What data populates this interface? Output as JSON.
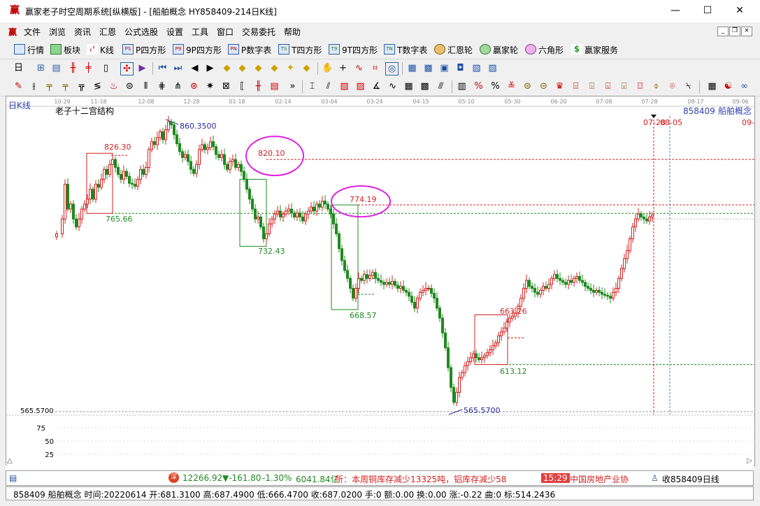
{
  "window": {
    "logo": "赢",
    "title": "赢家老子时空周期系统[纵横版] - [船舶概念  HY858409-214日K线]",
    "minimize": "—",
    "maximize": "☐",
    "close": "✕"
  },
  "menu": {
    "items": [
      "文件",
      "浏览",
      "资讯",
      "汇恩",
      "公式选股",
      "设置",
      "工具",
      "窗口",
      "交易委托",
      "帮助"
    ],
    "mdi_min": "_",
    "mdi_restore": "❐",
    "mdi_close": "×"
  },
  "nav": {
    "items": [
      "行情",
      "板块",
      "K线",
      "P四方形",
      "9P四方形",
      "P数字表",
      "T四方形",
      "9T四方形",
      "T数字表",
      "汇恩轮",
      "赢家轮",
      "六角形",
      "赢家服务"
    ],
    "icon_codes": [
      "",
      "",
      "",
      "PS",
      "P9",
      "PN",
      "TS",
      "T9",
      "TN",
      "",
      "",
      "",
      ""
    ]
  },
  "chart": {
    "period_label": "日K线",
    "structure_label": "老子十二宫结构",
    "code": "858409",
    "name": "船舶概念",
    "left_axis_price": "565.5700",
    "vol_ticks": [
      "75",
      "50",
      "25"
    ],
    "date_ticks": [
      "10-29",
      "11-18",
      "12-08",
      "12-28",
      "01-18",
      "02-14",
      "03-04",
      "03-24",
      "04-15",
      "05-10",
      "05-30",
      "06-20",
      "07-08",
      "07-28",
      "08-17",
      "09-06"
    ],
    "vline_labels": [
      "07-28",
      "08-05",
      "09-"
    ],
    "annotations": {
      "high": "860.3500",
      "p826": "826.30",
      "p820": "820.10",
      "p774": "774.19",
      "p765": "765.66",
      "p732": "732.43",
      "p668": "668.57",
      "p663": "663.26",
      "p613": "613.12",
      "low": "565.5700"
    },
    "colors": {
      "up": "#d42020",
      "down": "#1f8a1f",
      "ellipse": "#e020e0",
      "annot_blue": "#2a2aa0"
    }
  },
  "ticker": {
    "index_value": "12266.92",
    "change": "▼-161.80",
    "pct": "-1.30%",
    "amount": "6041.84亿",
    "news": "所：本周铜库存减少13325吨，铝库存减少58",
    "time": "15:29",
    "news2": "中国房地产业协",
    "follow": "收858409日线"
  },
  "status": {
    "text": "858409 船舶概念 时间:20220614 开:681.3100 高:687.4900 低:666.4700 收:687.0200 手:0 额:0.00 换:0.00 涨:-0.22 曲:0 标:514.2436"
  }
}
